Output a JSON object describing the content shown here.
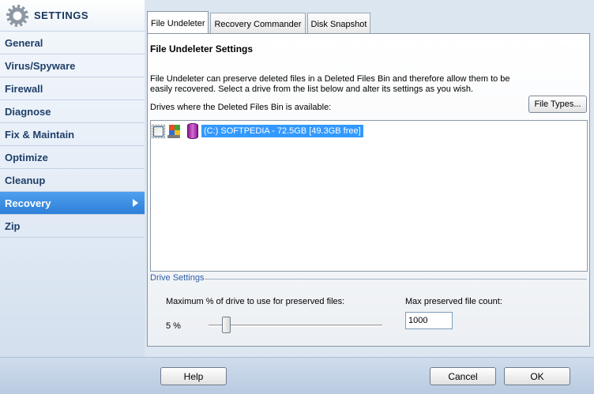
{
  "sidebar": {
    "title": "SETTINGS",
    "items": [
      {
        "label": "General"
      },
      {
        "label": "Virus/Spyware"
      },
      {
        "label": "Firewall"
      },
      {
        "label": "Diagnose"
      },
      {
        "label": "Fix & Maintain"
      },
      {
        "label": "Optimize"
      },
      {
        "label": "Cleanup"
      },
      {
        "label": "Recovery"
      },
      {
        "label": "Zip"
      }
    ],
    "active_index": 7
  },
  "tabs": [
    {
      "label": "File Undeleter"
    },
    {
      "label": "Recovery Commander"
    },
    {
      "label": "Disk Snapshot"
    }
  ],
  "panel": {
    "title": "File Undeleter Settings",
    "description": "File Undeleter can preserve deleted files in a Deleted Files Bin and therefore allow them to be easily recovered.  Select a drive from the list below and alter its settings as you wish.",
    "drives_label": "Drives where the Deleted Files Bin is available:",
    "file_types_button": "File Types...",
    "drives": [
      {
        "label": "(C:) SOFTPEDIA -  72.5GB [49.3GB free]",
        "checked": false
      }
    ],
    "drive_settings": {
      "legend": "Drive Settings",
      "max_pct_label": "Maximum % of drive to use for preserved files:",
      "pct_value": "5 %",
      "slider_fraction": 0.1,
      "max_count_label": "Max preserved file count:",
      "max_count_value": "1000"
    }
  },
  "footer": {
    "help": "Help",
    "cancel": "Cancel",
    "ok": "OK"
  },
  "colors": {
    "active_item": "#3a8ee6",
    "selection": "#3399ff",
    "legend": "#2e5ea8"
  }
}
